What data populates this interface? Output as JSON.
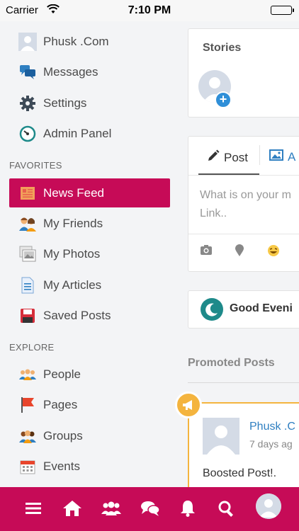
{
  "status_bar": {
    "carrier": "Carrier",
    "time": "7:10 PM"
  },
  "menu": {
    "top_items": [
      {
        "label": "Phusk .Com",
        "icon": "profile-avatar-icon"
      },
      {
        "label": "Messages",
        "icon": "messages-icon"
      },
      {
        "label": "Settings",
        "icon": "gear-icon"
      },
      {
        "label": "Admin Panel",
        "icon": "dashboard-gauge-icon"
      }
    ],
    "favorites_label": "FAVORITES",
    "favorites": [
      {
        "label": "News Feed",
        "icon": "newspaper-icon",
        "active": true
      },
      {
        "label": "My Friends",
        "icon": "friends-icon"
      },
      {
        "label": "My Photos",
        "icon": "photos-icon"
      },
      {
        "label": "My Articles",
        "icon": "document-icon"
      },
      {
        "label": "Saved Posts",
        "icon": "floppy-disk-icon"
      }
    ],
    "explore_label": "EXPLORE",
    "explore": [
      {
        "label": "People",
        "icon": "people-icon"
      },
      {
        "label": "Pages",
        "icon": "flag-icon"
      },
      {
        "label": "Groups",
        "icon": "groups-icon"
      },
      {
        "label": "Events",
        "icon": "calendar-icon"
      }
    ]
  },
  "feed": {
    "stories_title": "Stories",
    "composer": {
      "tab_post": "Post",
      "tab_album": "A",
      "placeholder_line1": "What is on your m",
      "placeholder_line2": "Link.."
    },
    "greeting": "Good Eveni",
    "promoted_title": "Promoted Posts",
    "promoted_post": {
      "author": "Phusk .C",
      "time": "7 days ag",
      "body": "Boosted Post!."
    }
  },
  "colors": {
    "accent": "#c60b57",
    "link": "#2f7fc1",
    "promo": "#f4b43e"
  }
}
